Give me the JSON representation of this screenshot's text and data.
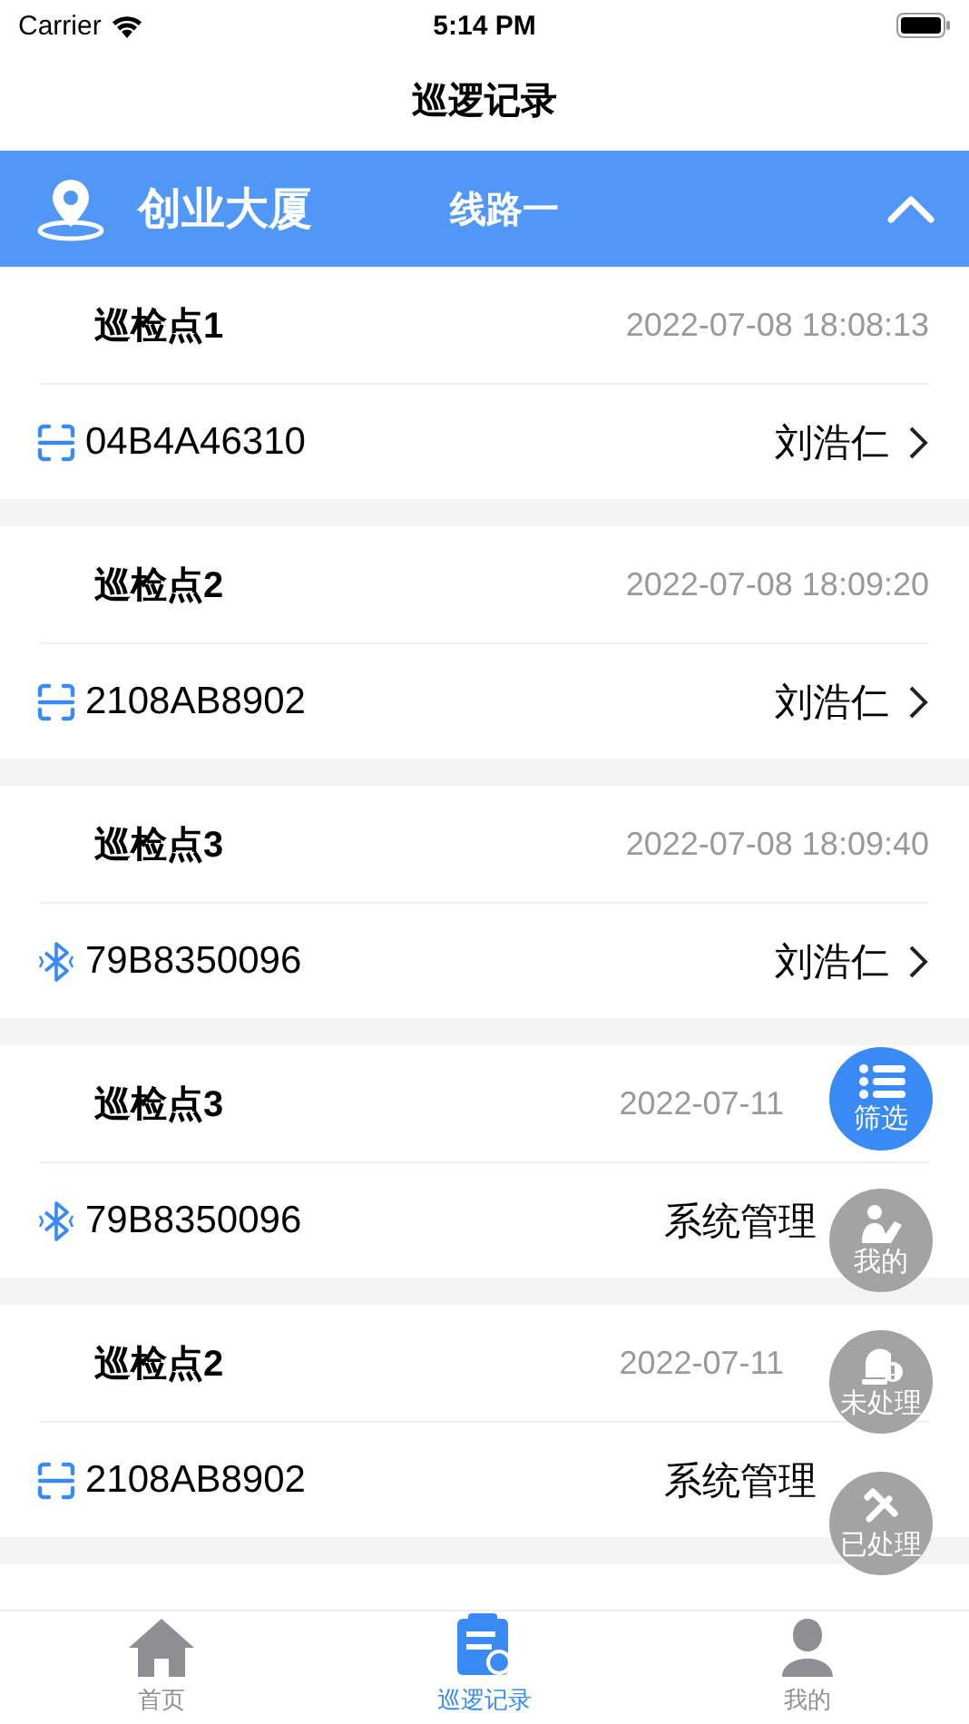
{
  "status_bar": {
    "carrier": "Carrier",
    "time": "5:14 PM"
  },
  "nav": {
    "title": "巡逻记录"
  },
  "site_bar": {
    "site": "创业大厦",
    "route": "线路一",
    "expanded": true
  },
  "records": [
    {
      "point": "巡检点1",
      "time": "2022-07-08 18:08:13",
      "kind": "scan",
      "code": "04B4A46310",
      "person": "刘浩仁"
    },
    {
      "point": "巡检点2",
      "time": "2022-07-08 18:09:20",
      "kind": "scan",
      "code": "2108AB8902",
      "person": "刘浩仁"
    },
    {
      "point": "巡检点3",
      "time": "2022-07-08 18:09:40",
      "kind": "bluetooth",
      "code": "79B8350096",
      "person": "刘浩仁"
    },
    {
      "point": "巡检点3",
      "time": "2022-07-11",
      "kind": "bluetooth",
      "code": "79B8350096",
      "person": "系统管理",
      "covered": true
    },
    {
      "point": "巡检点2",
      "time": "2022-07-11",
      "kind": "scan",
      "code": "2108AB8902",
      "person": "系统管理",
      "covered": true
    }
  ],
  "floating_buttons": [
    {
      "label": "筛选",
      "kind": "filter",
      "selected": true
    },
    {
      "label": "我的",
      "kind": "mine",
      "selected": false
    },
    {
      "label": "未处理",
      "kind": "pending",
      "selected": false
    },
    {
      "label": "已处理",
      "kind": "done",
      "selected": false
    }
  ],
  "tab_bar": [
    {
      "label": "首页",
      "kind": "home",
      "selected": false
    },
    {
      "label": "巡逻记录",
      "kind": "records",
      "selected": true
    },
    {
      "label": "我的",
      "kind": "profile",
      "selected": false
    }
  ]
}
